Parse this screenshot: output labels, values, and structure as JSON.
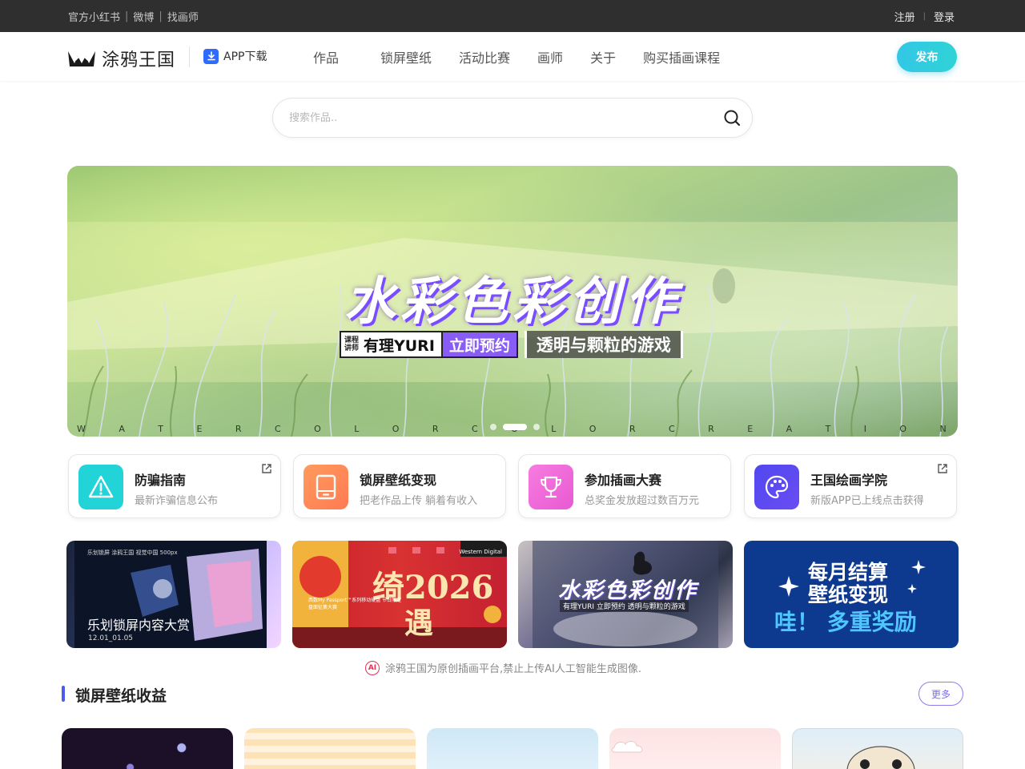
{
  "topbar": {
    "links": [
      "官方小红书",
      "微博",
      "找画师"
    ],
    "sep": "|",
    "register": "注册",
    "login": "登录"
  },
  "header": {
    "logo_text": "涂鸦王国",
    "app_download": "APP下载",
    "nav": [
      "作品",
      "锁屏壁纸",
      "活动比赛",
      "画师",
      "关于",
      "购买插画课程"
    ],
    "publish": "发布"
  },
  "search": {
    "placeholder": "搜索作品.."
  },
  "banner": {
    "title": "水彩色彩创作",
    "lecturer_label": "课程讲师",
    "lecturer_name": "有理YURI",
    "reserve": "立即预约",
    "topic": "透明与颗粒的游戏",
    "sub_letters": [
      "W",
      "A",
      "T",
      "E",
      "R",
      "C",
      "O",
      "L",
      "O",
      "R",
      "C",
      "O",
      "L",
      "O",
      "R",
      "C",
      "R",
      "E",
      "A",
      "T",
      "I",
      "O",
      "N"
    ],
    "active_slide": 2,
    "slide_count": 3
  },
  "features": [
    {
      "title": "防骗指南",
      "desc": "最新诈骗信息公布",
      "icon": "warning-icon",
      "color": "#22d3d8",
      "external": true
    },
    {
      "title": "锁屏壁纸变现",
      "desc": "把老作品上传 躺着有收入",
      "icon": "tablet-icon",
      "color": "#ff8a5b",
      "external": false
    },
    {
      "title": "参加插画大赛",
      "desc": "总奖金发放超过数百万元",
      "icon": "trophy-icon",
      "color": "#f06bd8",
      "external": false
    },
    {
      "title": "王国绘画学院",
      "desc": "新版APP已上线点击获得",
      "icon": "palette-icon",
      "color": "#5b4cf0",
      "external": true
    }
  ],
  "promos": {
    "p1": {
      "title": "乐划锁屏内容大赏",
      "date": "12.01_01.05",
      "header": "乐划锁屏 涂鸦王国 视觉中国 500px"
    },
    "p2": {
      "big_a": "绮2026",
      "big_b": "遇",
      "brand": "Western Digital",
      "sub": "西数My Passport™系列移动硬盘 节日限定盘面征集大赛"
    },
    "p3": {
      "title": "水彩色彩创作",
      "tags": "有理YURI 立即预约 透明与颗粒的游戏"
    },
    "p4": {
      "line1": "每月结算",
      "line2": "壁纸变现",
      "line3": "哇！ 多重奖励"
    }
  },
  "ai_notice": {
    "icon": "AI",
    "text": "涂鸦王国为原创插画平台,禁止上传AI人工智能生成图像."
  },
  "section": {
    "title": "锁屏壁纸收益",
    "more": "更多"
  }
}
